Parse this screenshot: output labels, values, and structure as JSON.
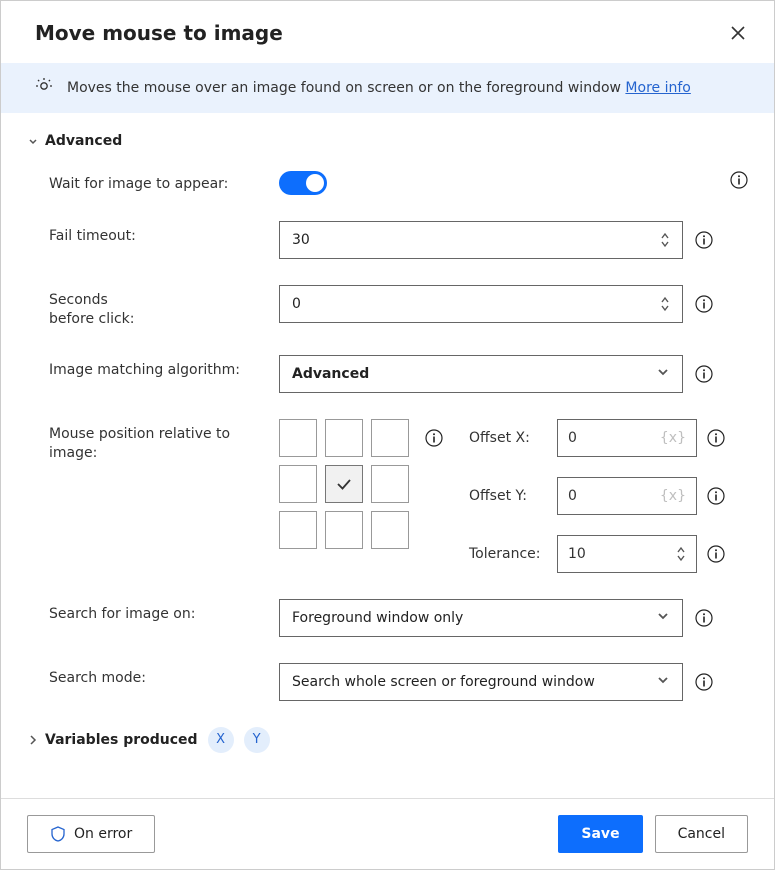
{
  "header": {
    "title": "Move mouse to image"
  },
  "banner": {
    "text": "Moves the mouse over an image found on screen or on the foreground window ",
    "link": "More info"
  },
  "section": {
    "advanced_label": "Advanced",
    "variables_label": "Variables produced"
  },
  "fields": {
    "wait_label": "Wait for image to appear:",
    "fail_timeout_label": "Fail timeout:",
    "fail_timeout_value": "30",
    "seconds_before_label": "Seconds\nbefore click:",
    "seconds_before_value": "0",
    "algorithm_label": "Image matching algorithm:",
    "algorithm_value": "Advanced",
    "mouse_pos_label": "Mouse position relative to image:",
    "offset_x_label": "Offset X:",
    "offset_x_value": "0",
    "offset_y_label": "Offset Y:",
    "offset_y_value": "0",
    "tolerance_label": "Tolerance:",
    "tolerance_value": "10",
    "search_on_label": "Search for image on:",
    "search_on_value": "Foreground window only",
    "search_mode_label": "Search mode:",
    "search_mode_value": "Search whole screen or foreground window",
    "var_placeholder": "{x}"
  },
  "variables": {
    "chips": [
      "X",
      "Y"
    ]
  },
  "footer": {
    "on_error": "On error",
    "save": "Save",
    "cancel": "Cancel"
  }
}
